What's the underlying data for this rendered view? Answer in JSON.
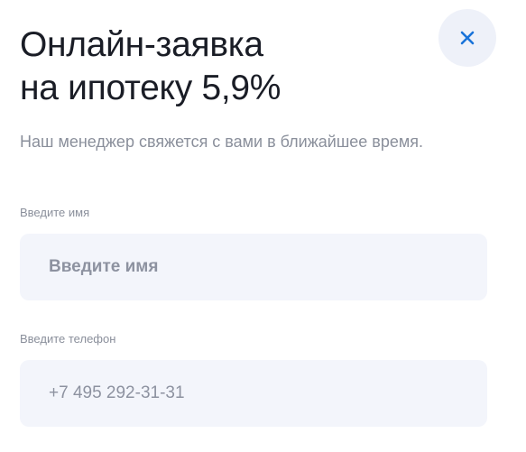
{
  "dialog": {
    "title_line1": "Онлайн-заявка",
    "title_line2": "на ипотеку 5,9%",
    "subtitle": "Наш менеджер свяжется с вами в ближайшее время.",
    "close_icon": "close-icon",
    "accent_color": "#1a73d9"
  },
  "form": {
    "name": {
      "label": "Введите имя",
      "placeholder": "Введите имя",
      "value": ""
    },
    "phone": {
      "label": "Введите телефон",
      "placeholder": "+7 495 292-31-31",
      "value": ""
    }
  }
}
